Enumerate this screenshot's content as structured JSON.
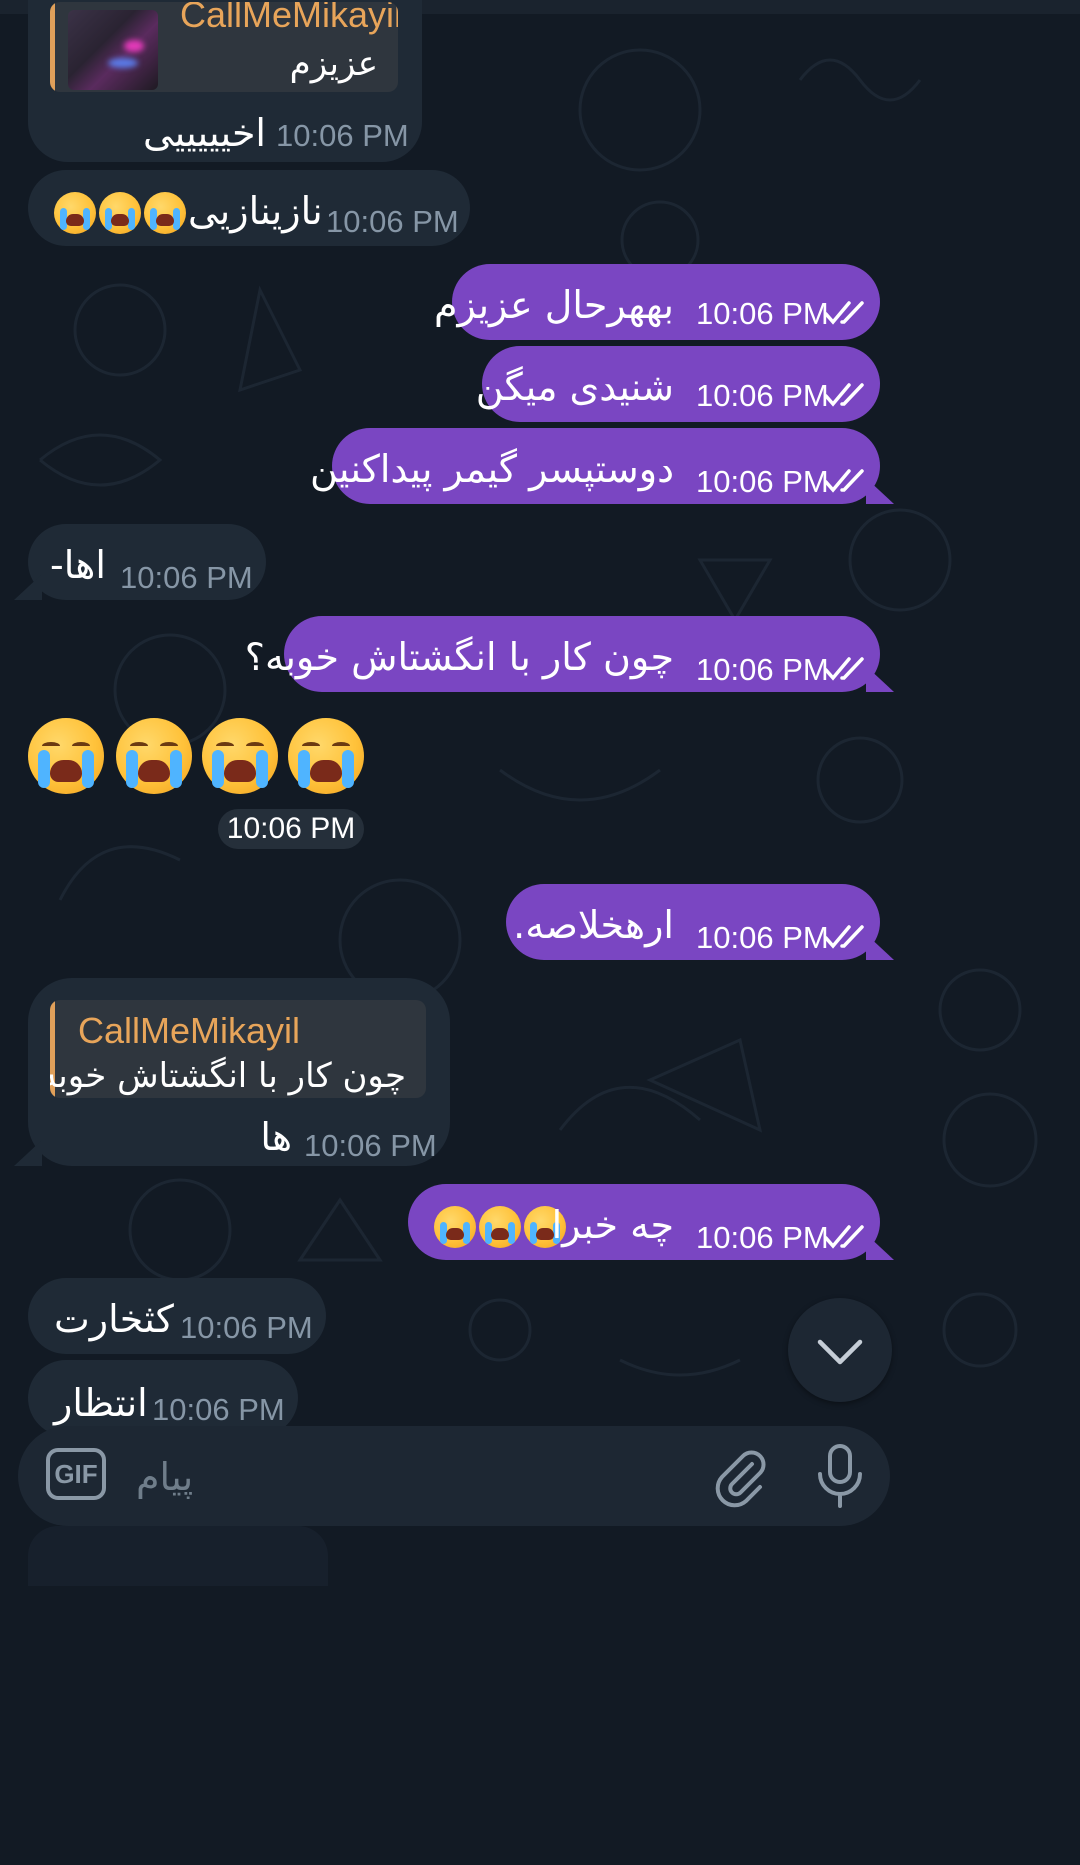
{
  "messages": [
    {
      "id": "m1",
      "dir": "in",
      "reply_name": "CallMeMikayil",
      "reply_text": "عزیزم",
      "text": "اخیییییی",
      "time": "10:06 PM"
    },
    {
      "id": "m2",
      "dir": "in",
      "text": "نازینازیی",
      "emoji_count": 3,
      "time": "10:06 PM"
    },
    {
      "id": "m3",
      "dir": "out",
      "text": "بههرحال عزیزم",
      "time": "10:06 PM",
      "status": "read"
    },
    {
      "id": "m4",
      "dir": "out",
      "text": "شنیدی میگن",
      "time": "10:06 PM",
      "status": "read"
    },
    {
      "id": "m5",
      "dir": "out",
      "text": "دوستپسر گیمر پیداکنین",
      "time": "10:06 PM",
      "status": "read"
    },
    {
      "id": "m6",
      "dir": "in",
      "text": "اها-",
      "time": "10:06 PM"
    },
    {
      "id": "m7",
      "dir": "out",
      "text": "چون کار با انگشتاش خوبه؟",
      "time": "10:06 PM",
      "status": "read"
    },
    {
      "id": "m8",
      "dir": "in",
      "type": "emoji-only",
      "emoji_count": 4,
      "time": "10:06 PM"
    },
    {
      "id": "m9",
      "dir": "out",
      "text": "ارهخلاصه.",
      "time": "10:06 PM",
      "status": "read"
    },
    {
      "id": "m10",
      "dir": "in",
      "reply_name": "CallMeMikayil",
      "reply_text": "چون کار با انگشتاش خوبه؟",
      "text": "ها",
      "time": "10:06 PM"
    },
    {
      "id": "m11",
      "dir": "out",
      "text": "چه خبرا",
      "emoji_count": 3,
      "time": "10:06 PM",
      "status": "read"
    },
    {
      "id": "m12",
      "dir": "in",
      "text": "کثخارت",
      "time": "10:06 PM"
    },
    {
      "id": "m13",
      "dir": "in",
      "text": "انتظار",
      "time": "10:06 PM"
    }
  ],
  "composer": {
    "gif_label": "GIF",
    "placeholder": "پیام"
  },
  "icons": {
    "read_status": "double-check-icon",
    "scroll": "chevron-down-icon",
    "attach": "paperclip-icon",
    "mic": "microphone-icon",
    "emoji": "loudly-crying-face"
  },
  "colors": {
    "background": "#121a24",
    "incoming_bubble": "#1f2a36",
    "outgoing_bubble": "#7a46c2",
    "reply_name": "#e8a55a",
    "time_incoming": "#8696a6"
  }
}
